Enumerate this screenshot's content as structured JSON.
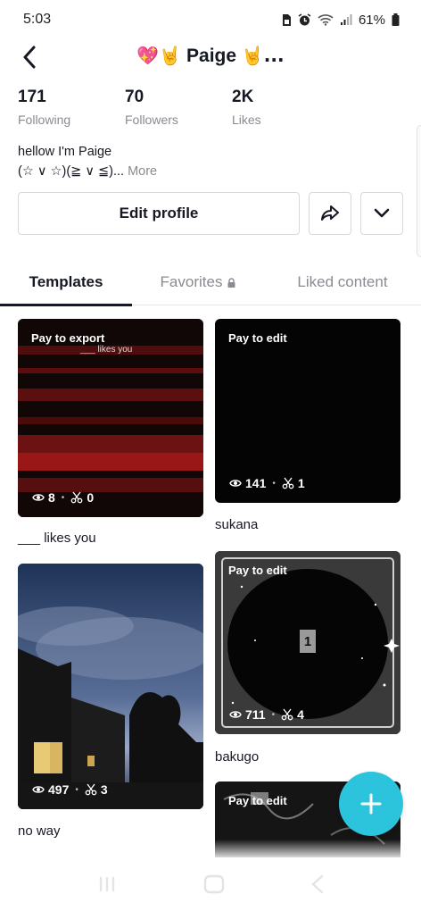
{
  "status_bar": {
    "time": "5:03",
    "battery": "61%"
  },
  "header": {
    "title_emoji_left": "💖🤘",
    "title_name": "Paige",
    "title_emoji_right": "🤘...",
    "icons": {
      "back": "back-arrow-icon"
    }
  },
  "stats": [
    {
      "value": "171",
      "label": "Following"
    },
    {
      "value": "70",
      "label": "Followers"
    },
    {
      "value": "2K",
      "label": "Likes"
    }
  ],
  "bio": {
    "line1": "hellow I'm Paige",
    "line2": "(☆ ∨ ☆)(≧ ∨ ≦)...",
    "more": "More"
  },
  "actions": {
    "edit_profile": "Edit profile",
    "share_icon": "share-icon",
    "dropdown_icon": "chevron-down-icon"
  },
  "tabs": [
    {
      "label": "Templates",
      "active": true
    },
    {
      "label": "Favorites",
      "active": false,
      "icon": "lock-icon"
    },
    {
      "label": "Liked content",
      "active": false
    }
  ],
  "grid": {
    "items": [
      {
        "badge": "Pay to export",
        "overlay_text": "___ likes you",
        "views": "8",
        "uses": "0",
        "title": "___ likes you"
      },
      {
        "badge": "Pay to edit",
        "views": "141",
        "uses": "1",
        "title": "sukana"
      },
      {
        "badge": "",
        "views": "497",
        "uses": "3",
        "title": "no way"
      },
      {
        "badge": "Pay to edit",
        "center_number": "1",
        "views": "711",
        "uses": "4",
        "title": "bakugo"
      },
      {
        "badge": "Pay to edit",
        "views": "",
        "uses": "",
        "title": ""
      }
    ]
  },
  "fab": {
    "icon": "plus-icon"
  },
  "colors": {
    "accent": "#2bc4dc",
    "text": "#161823",
    "muted": "#8a8b91"
  }
}
